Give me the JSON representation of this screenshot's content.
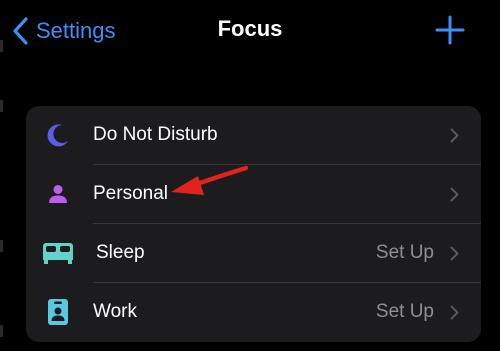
{
  "navbar": {
    "back_label": "Settings",
    "title": "Focus"
  },
  "colors": {
    "accent": "#3d8ef7",
    "background": "#000000",
    "group_background": "#1c1c1e",
    "secondary_text": "#8e8e93",
    "annotation_arrow": "#e0231b"
  },
  "focus_list": [
    {
      "label": "Do Not Disturb",
      "icon": "moon-icon",
      "icon_color": "#5e5ce6",
      "value": ""
    },
    {
      "label": "Personal",
      "icon": "person-icon",
      "icon_color": "#bf5af2",
      "value": ""
    },
    {
      "label": "Sleep",
      "icon": "bed-icon",
      "icon_color": "#64d2c8",
      "value": "Set Up"
    },
    {
      "label": "Work",
      "icon": "id-badge-icon",
      "icon_color": "#5ac8e0",
      "value": "Set Up"
    }
  ]
}
